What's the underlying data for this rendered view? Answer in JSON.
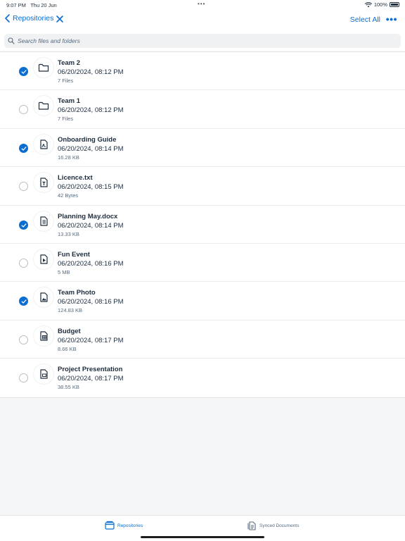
{
  "status_bar": {
    "time": "9:07 PM",
    "date": "Thu 20 Jun",
    "battery": "100%"
  },
  "nav": {
    "back_label": "Repositories",
    "select_all_label": "Select All",
    "more_label": "•••"
  },
  "search": {
    "placeholder": "Search files and folders"
  },
  "items": [
    {
      "name": "Team 2",
      "date": "06/20/2024, 08:12 PM",
      "size": "7 Files",
      "icon": "folder-icon",
      "selected": true
    },
    {
      "name": "Team 1",
      "date": "06/20/2024, 08:12 PM",
      "size": "7 Files",
      "icon": "folder-icon",
      "selected": false
    },
    {
      "name": "Onboarding Guide",
      "date": "06/20/2024, 08:14 PM",
      "size": "16.28 KB",
      "icon": "pdf-document-icon",
      "selected": true
    },
    {
      "name": "Licence.txt",
      "date": "06/20/2024, 08:15 PM",
      "size": "42 Bytes",
      "icon": "text-document-icon",
      "selected": false
    },
    {
      "name": "Planning May.docx",
      "date": "06/20/2024, 08:14 PM",
      "size": "13.33 KB",
      "icon": "word-document-icon",
      "selected": true
    },
    {
      "name": "Fun Event",
      "date": "06/20/2024, 08:16 PM",
      "size": "5 MB",
      "icon": "video-document-icon",
      "selected": false
    },
    {
      "name": "Team Photo",
      "date": "06/20/2024, 08:16 PM",
      "size": "124.83 KB",
      "icon": "image-document-icon",
      "selected": true
    },
    {
      "name": "Budget",
      "date": "06/20/2024, 08:17 PM",
      "size": "8.66 KB",
      "icon": "spreadsheet-document-icon",
      "selected": false
    },
    {
      "name": "Project Presentation",
      "date": "06/20/2024, 08:17 PM",
      "size": "38.55 KB",
      "icon": "presentation-document-icon",
      "selected": false
    }
  ],
  "tabs": [
    {
      "label": "Repositories",
      "icon": "repositories-icon",
      "active": true
    },
    {
      "label": "Synced Documents",
      "icon": "synced-documents-icon",
      "active": false
    }
  ],
  "colors": {
    "accent": "#0a6ed1",
    "text": "#1d2d3e",
    "secondary_text": "#556b82",
    "background": "#f5f6f7"
  }
}
